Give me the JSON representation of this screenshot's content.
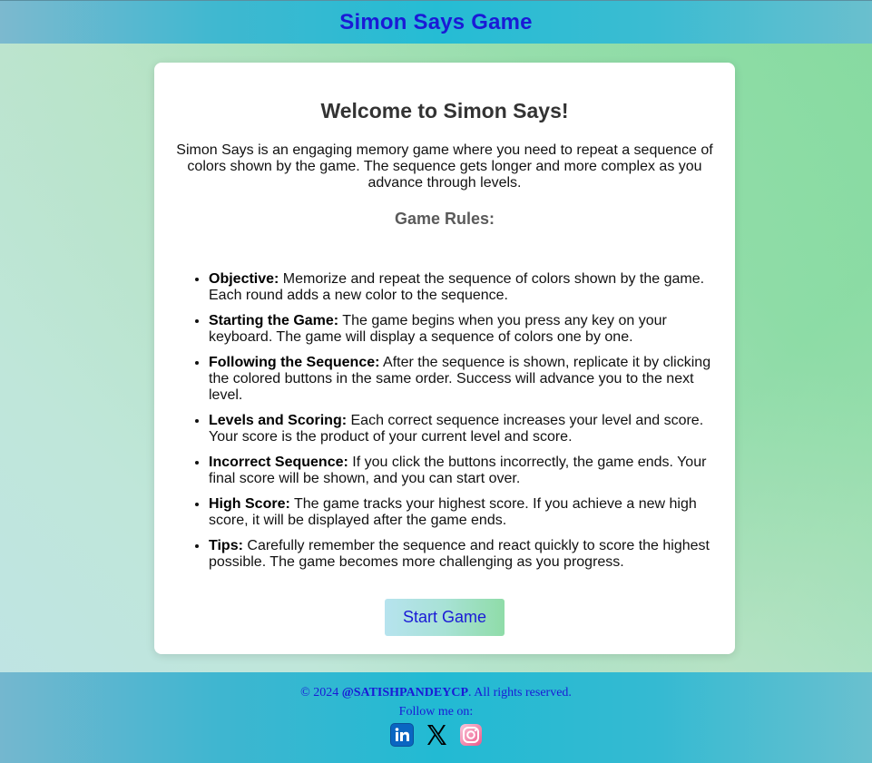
{
  "header": {
    "title": "Simon Says Game"
  },
  "card": {
    "heading": "Welcome to Simon Says!",
    "intro": "Simon Says is an engaging memory game where you need to repeat a sequence of colors shown by the game. The sequence gets longer and more complex as you advance through levels.",
    "rules_title": "Game Rules:",
    "rules": [
      {
        "term": "Objective:",
        "text": " Memorize and repeat the sequence of colors shown by the game. Each round adds a new color to the sequence."
      },
      {
        "term": "Starting the Game:",
        "text": " The game begins when you press any key on your keyboard. The game will display a sequence of colors one by one."
      },
      {
        "term": "Following the Sequence:",
        "text": " After the sequence is shown, replicate it by clicking the colored buttons in the same order. Success will advance you to the next level."
      },
      {
        "term": "Levels and Scoring:",
        "text": " Each correct sequence increases your level and score. Your score is the product of your current level and score."
      },
      {
        "term": "Incorrect Sequence:",
        "text": " If you click the buttons incorrectly, the game ends. Your final score will be shown, and you can start over."
      },
      {
        "term": "High Score:",
        "text": " The game tracks your highest score. If you achieve a new high score, it will be displayed after the game ends."
      },
      {
        "term": "Tips:",
        "text": " Carefully remember the sequence and react quickly to score the highest possible. The game becomes more challenging as you progress."
      }
    ],
    "start_button": "Start Game"
  },
  "footer": {
    "copyright_prefix": "© 2024 ",
    "handle": "@SATISHPANDEYCP",
    "copyright_suffix": ". All rights reserved.",
    "follow_label": "Follow me on:",
    "socials": [
      {
        "name": "linkedin-icon",
        "color": "#0a66c2"
      },
      {
        "name": "x-twitter-icon",
        "color": "#000000"
      },
      {
        "name": "instagram-icon",
        "color": "#ec5a8a"
      }
    ]
  },
  "colors": {
    "accent_blue": "#1a1ad6",
    "header_bar": "#25bcd4"
  }
}
